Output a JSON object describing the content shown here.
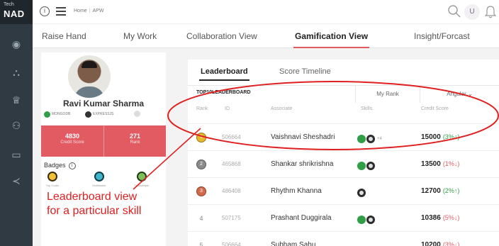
{
  "app": {
    "logo_top": "Tech",
    "logo_main": "NAD",
    "breadcrumb": [
      "Home",
      "APW"
    ]
  },
  "topbar": {
    "user_initial": "U",
    "icons": [
      "info-icon",
      "menu-icon",
      "search-icon",
      "bell-icon"
    ]
  },
  "nav_tabs": [
    {
      "label": "Raise Hand",
      "active": false
    },
    {
      "label": "My Work",
      "active": false
    },
    {
      "label": "Collaboration View",
      "active": false
    },
    {
      "label": "Gamification View",
      "active": true
    },
    {
      "label": "Insight/Forcast",
      "active": false
    }
  ],
  "sidebar_icons": [
    "dashboard-icon",
    "analytics-icon",
    "trophy-icon",
    "group-icon",
    "monitor-icon",
    "share-icon"
  ],
  "profile": {
    "name": "Ravi Kumar Sharma",
    "skills": [
      "MONGODB",
      "EXPRESSJS"
    ],
    "credit_score": "4830",
    "credit_score_label": "Credit Score",
    "rank": "271",
    "rank_label": "Rank",
    "badges_title": "Badges",
    "badges": [
      {
        "label": "Top Coder",
        "color": "#d9a300"
      },
      {
        "label": "Multitasker",
        "color": "#1a8aa0"
      },
      {
        "label": "Timekeeper",
        "color": "#3d8a3a"
      }
    ]
  },
  "leaderboard": {
    "tabs": [
      {
        "label": "Leaderboard",
        "active": true
      },
      {
        "label": "Score Timeline",
        "active": false
      }
    ],
    "heading": "TOP10LEADERBOARD",
    "my_rank_label": "My Rank",
    "skill_filter": "Angular",
    "columns": [
      "Rank",
      "ID",
      "Associate",
      "Skills",
      "Credit Score"
    ],
    "rows": [
      {
        "rank": "1",
        "id": "506664",
        "associate": "Vaishnavi Sheshadri",
        "skills": [
          "g",
          "k"
        ],
        "more": "+4",
        "score": "15000",
        "change": "(3%↑)",
        "dir": "up",
        "medal": "#e8b82a"
      },
      {
        "rank": "2",
        "id": "465868",
        "associate": "Shankar shrikrishna",
        "skills": [
          "g",
          "k"
        ],
        "more": "",
        "score": "13500",
        "change": "(1%↓)",
        "dir": "down",
        "medal": "#8b8b8b"
      },
      {
        "rank": "3",
        "id": "486408",
        "associate": "Rhythm Khanna",
        "skills": [
          "k"
        ],
        "more": "",
        "score": "12700",
        "change": "(2%↑)",
        "dir": "up",
        "medal": "#d46a4a"
      },
      {
        "rank": "4",
        "id": "507175",
        "associate": "Prashant Duggirala",
        "skills": [
          "g",
          "k"
        ],
        "more": "",
        "score": "10386",
        "change": "(5%↓)",
        "dir": "down",
        "medal": ""
      },
      {
        "rank": "5",
        "id": "506664",
        "associate": "Subham Sahu",
        "skills": [],
        "more": "",
        "score": "10200",
        "change": "(3%↓)",
        "dir": "down",
        "medal": ""
      }
    ]
  },
  "annotation": {
    "line1": "Leaderboard view",
    "line2": "for a particular skill",
    "color": "#e02020"
  },
  "colors": {
    "accent": "#e35b62",
    "rail": "#2f3a42"
  }
}
